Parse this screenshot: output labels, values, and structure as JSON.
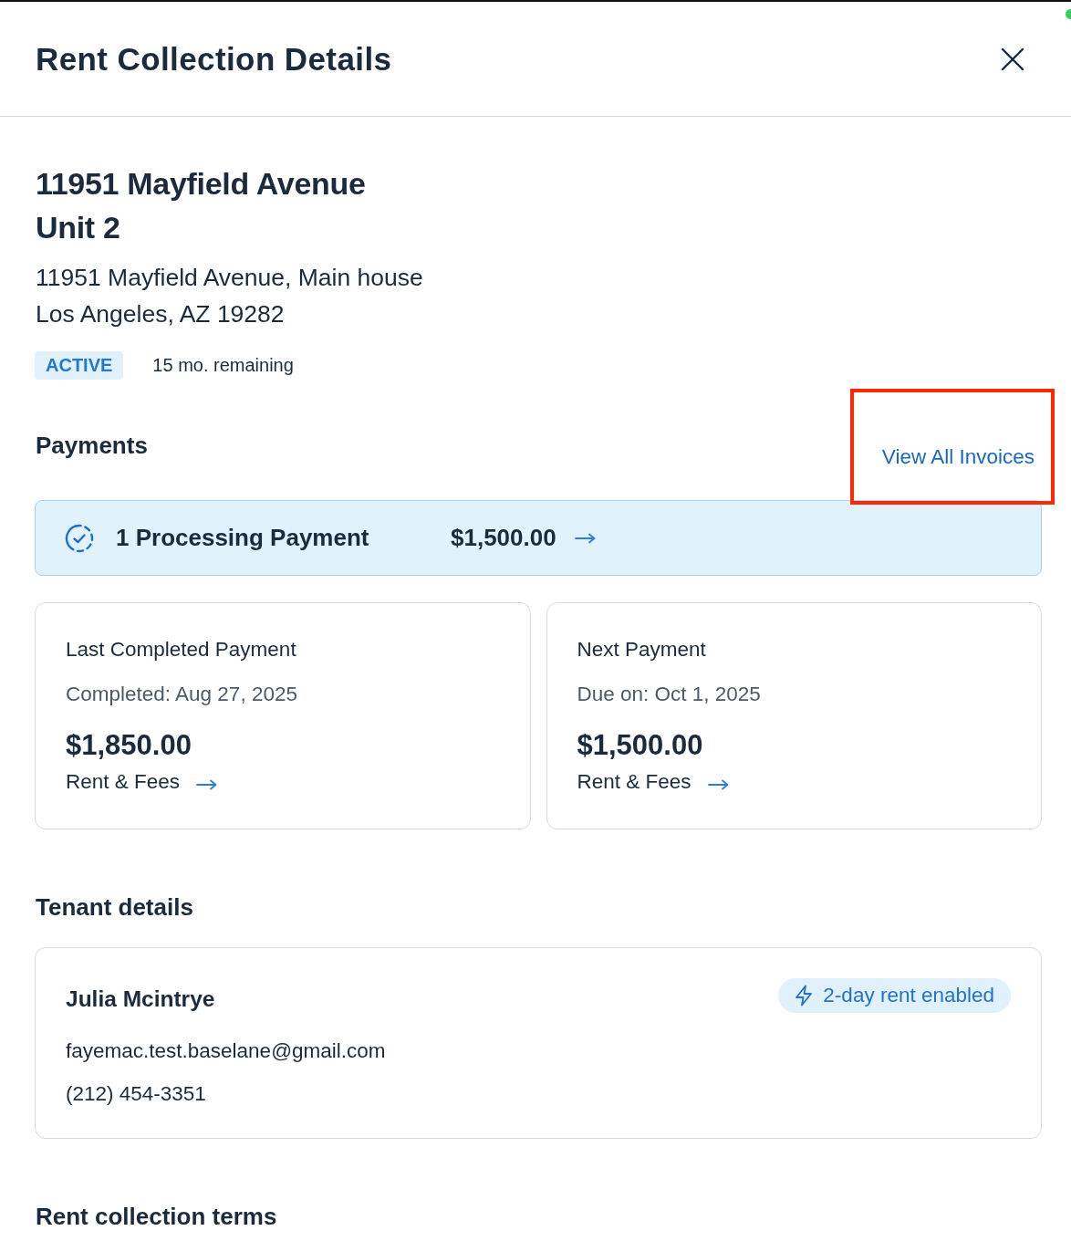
{
  "window": {
    "title": "Rent Collection Details"
  },
  "property": {
    "title_lines": [
      "11951 Mayfield Avenue",
      "Unit 2"
    ],
    "address_lines": [
      "11951 Mayfield Avenue, Main house",
      "Los Angeles, AZ 19282"
    ],
    "status": "ACTIVE",
    "remaining": "15 mo. remaining"
  },
  "payments": {
    "heading": "Payments",
    "view_all": {
      "label": "View All Invoices",
      "highlighted": true
    },
    "processing": {
      "label": "1 Processing Payment",
      "amount": "$1,500.00"
    },
    "cards": [
      {
        "title": "Last Completed Payment",
        "date": "Completed: Aug 27, 2025",
        "amount": "$1,850.00",
        "link": "Rent & Fees"
      },
      {
        "title": "Next Payment",
        "date": "Due on: Oct 1, 2025",
        "amount": "$1,500.00",
        "link": "Rent & Fees"
      }
    ]
  },
  "tenant": {
    "heading": "Tenant details",
    "name": "Julia Mcintrye",
    "email": "fayemac.test.baselane@gmail.com",
    "phone": "(212) 454-3351",
    "badge": "2-day rent enabled"
  },
  "terms": {
    "heading": "Rent collection terms"
  }
}
